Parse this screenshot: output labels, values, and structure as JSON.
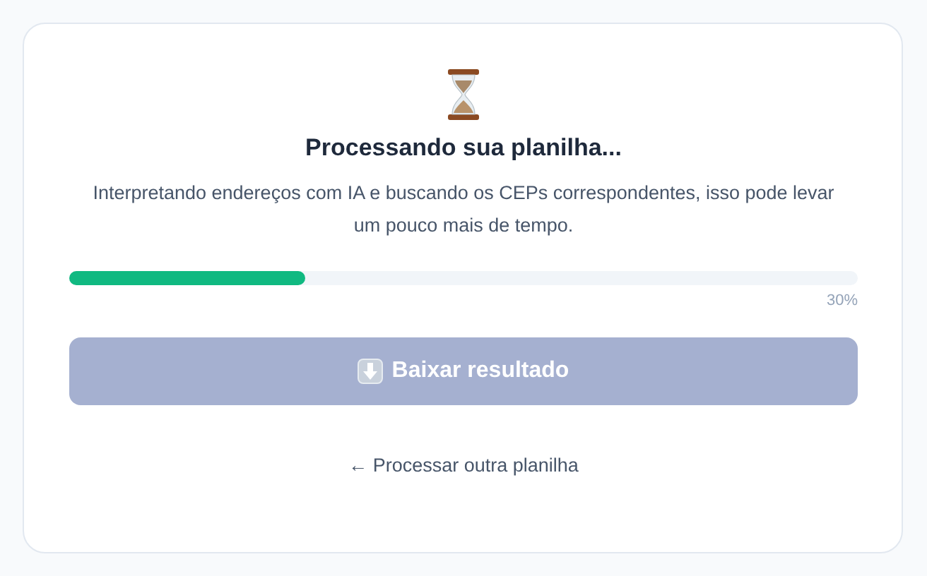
{
  "status": {
    "title": "Processando sua planilha...",
    "description": "Interpretando endereços com IA e buscando os CEPs correspondentes, isso pode levar um pouco mais de tempo."
  },
  "progress": {
    "level": 0.3,
    "reading": "30%"
  },
  "download_button": {
    "label": "Baixar resultado",
    "disabled": true
  },
  "back_link": {
    "label": "← Processar outra planilha"
  }
}
